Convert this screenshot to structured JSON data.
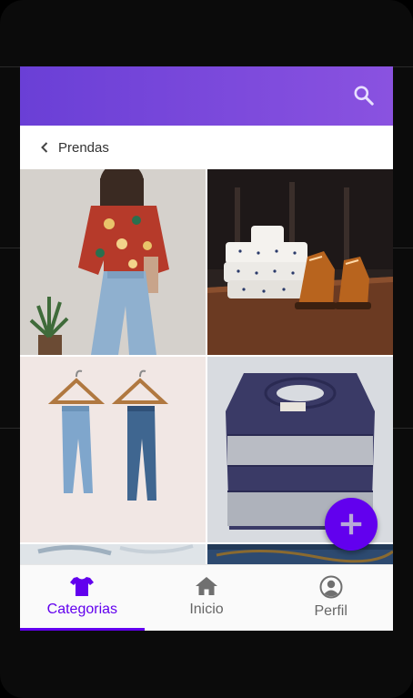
{
  "colors": {
    "primary": "#6200ee",
    "appbar_start": "#6a3fd6",
    "appbar_end": "#8a52e0",
    "nav_inactive": "#666666"
  },
  "appbar": {
    "search_icon": "search-icon"
  },
  "breadcrumb": {
    "back_icon": "chevron-left-icon",
    "label": "Prendas"
  },
  "gallery": {
    "items": [
      {
        "name": "floral-shirt-jeans-photo"
      },
      {
        "name": "shirts-and-brown-shoes-photo"
      },
      {
        "name": "jeans-on-hangers-photo"
      },
      {
        "name": "striped-knit-sweater-photo"
      },
      {
        "name": "partial-photo-bottom-left"
      },
      {
        "name": "partial-photo-bottom-right"
      }
    ]
  },
  "fab": {
    "icon": "add-icon"
  },
  "bottom_nav": {
    "active_index": 0,
    "items": [
      {
        "label": "Categorias",
        "icon": "shirt-icon"
      },
      {
        "label": "Inicio",
        "icon": "home-icon"
      },
      {
        "label": "Perfil",
        "icon": "account-circle-icon"
      }
    ]
  }
}
